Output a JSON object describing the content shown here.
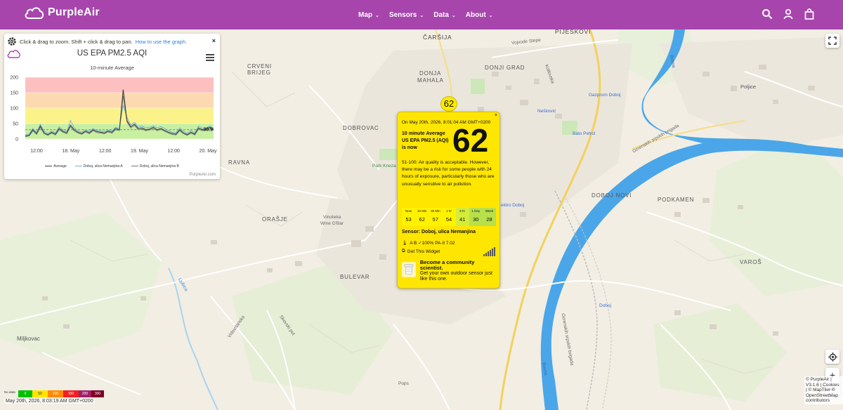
{
  "header": {
    "brand": "PurpleAir",
    "nav": [
      {
        "label": "Map"
      },
      {
        "label": "Sensors"
      },
      {
        "label": "Data"
      },
      {
        "label": "About"
      }
    ],
    "icons": [
      "search-icon",
      "account-icon",
      "cart-icon"
    ]
  },
  "map": {
    "places": [
      {
        "name": "ČARŠIJA"
      },
      {
        "name": "PIJESKOVI"
      },
      {
        "name": "CRVENI"
      },
      {
        "name": "BRIJEG"
      },
      {
        "name": "DONJA"
      },
      {
        "name": "MAHALA"
      },
      {
        "name": "DONJI GRAD"
      },
      {
        "name": "DOBROVAC"
      },
      {
        "name": "RAVNA"
      },
      {
        "name": "ORAŠJE"
      },
      {
        "name": "BULEVAR"
      },
      {
        "name": "DOBOJ NOVI"
      },
      {
        "name": "PODKAMEN"
      },
      {
        "name": "VAROŠ"
      },
      {
        "name": "Miljkovac"
      },
      {
        "name": "Poljice"
      }
    ],
    "pois": [
      {
        "name": "Gazprom Doboj"
      },
      {
        "name": "Nešković"
      },
      {
        "name": "Bato Petrol"
      },
      {
        "name": "Park Kneza"
      },
      {
        "name": "Vinoteka"
      },
      {
        "name": "Wine O'Bar"
      },
      {
        "name": "ektro Doboj"
      },
      {
        "name": "Doboj"
      },
      {
        "name": "Pops"
      }
    ],
    "streets": [
      {
        "name": "Vojvode Stepe"
      },
      {
        "name": "Kotlovska"
      },
      {
        "name": "Ozrenskih srpskih brigada"
      },
      {
        "name": "Bosna"
      },
      {
        "name": "Ljubica"
      },
      {
        "name": "Vidovdanska"
      },
      {
        "name": "Skovski put"
      },
      {
        "name": "Ozrenskih srpskih brigada"
      },
      {
        "name": "Bosna"
      }
    ]
  },
  "chart_panel": {
    "help_text": "Click & drag to zoom. Shift + click & drag to pan.",
    "help_link": "How to use the graph.",
    "close": "×",
    "title": "US EPA PM2.5 AQI",
    "subtitle": "10-minute Average",
    "credit": "PurpleAir.com",
    "last_value_label": "30.9"
  },
  "chart_data": {
    "type": "line",
    "title": "US EPA PM2.5 AQI",
    "subtitle": "10-minute Average",
    "ylim": [
      0,
      200
    ],
    "y_ticks": [
      0,
      50,
      100,
      150,
      200
    ],
    "x_ticks": [
      "12:00",
      "18. May",
      "12:00",
      "19. May",
      "12:00",
      "20. May"
    ],
    "bands": [
      {
        "from": 0,
        "to": 50,
        "color": "#c8f0a0"
      },
      {
        "from": 50,
        "to": 100,
        "color": "#fbf28a"
      },
      {
        "from": 100,
        "to": 150,
        "color": "#fcd9b0"
      },
      {
        "from": 150,
        "to": 200,
        "color": "#fdc0c0"
      }
    ],
    "series": [
      {
        "name": "Average",
        "color": "#444444",
        "values": [
          10,
          12,
          30,
          18,
          42,
          20,
          14,
          22,
          16,
          34,
          25,
          20,
          45,
          30,
          22,
          18,
          26,
          20,
          30,
          24,
          22,
          20,
          26,
          22,
          34,
          30,
          160,
          60,
          40,
          48,
          34,
          36,
          30,
          32,
          38,
          30,
          34,
          28,
          22,
          18,
          16,
          30,
          20,
          14,
          22,
          16,
          36,
          30,
          32,
          38,
          30.9
        ]
      },
      {
        "name": "Doboj, ulica Nemanjina A",
        "color": "#6aaee0",
        "values": [
          14,
          16,
          34,
          22,
          48,
          26,
          18,
          26,
          20,
          40,
          30,
          24,
          60,
          36,
          26,
          22,
          30,
          24,
          34,
          28,
          26,
          24,
          30,
          26,
          38,
          34,
          110,
          70,
          46,
          54,
          40,
          42,
          36,
          38,
          42,
          36,
          40,
          34,
          28,
          22,
          20,
          36,
          26,
          18,
          28,
          20,
          42,
          34,
          36,
          42,
          34
        ]
      },
      {
        "name": "Doboj, ulica Nemanjina B",
        "color": "#777777",
        "values": [
          8,
          10,
          26,
          15,
          38,
          17,
          12,
          19,
          13,
          30,
          22,
          17,
          40,
          26,
          19,
          15,
          23,
          17,
          27,
          21,
          19,
          17,
          23,
          19,
          30,
          27,
          140,
          55,
          36,
          44,
          30,
          32,
          27,
          29,
          34,
          27,
          31,
          25,
          19,
          15,
          13,
          27,
          17,
          12,
          19,
          13,
          32,
          27,
          29,
          34,
          28
        ]
      }
    ]
  },
  "marker": {
    "value": "62"
  },
  "popup": {
    "close": "×",
    "date": "On May 20th, 2026, 8:01:04 AM GMT+0200",
    "avg_label": "10 minute Average US EPA PM2.5 (AQI) is now",
    "value": "62",
    "description": "51-100: Air quality is acceptable. However, there may be a risk for some people with 24 hours of exposure, particularly those who are unusually sensitive to air pollution.",
    "history": [
      {
        "label": "Now",
        "value": "53"
      },
      {
        "label": "10 Min",
        "value": "62"
      },
      {
        "label": "30 Min",
        "value": "57"
      },
      {
        "label": "1 hr",
        "value": "54"
      },
      {
        "label": "6 hr",
        "value": "41"
      },
      {
        "label": "1 Day",
        "value": "30"
      },
      {
        "label": "Week",
        "value": "28"
      }
    ],
    "sensor_name": "Sensor: Doboj, ulica Nemanjina",
    "sensor_meta": "A B ✓100% PA-II 7.02",
    "widget_link": "Get This Widget",
    "community_title": "Become a community scientist.",
    "community_text": "Get your own outdoor sensor just like this one."
  },
  "scale": {
    "label": "No data",
    "segments": [
      {
        "value": "0",
        "color": "#00c000"
      },
      {
        "value": "50",
        "color": "#ffe400"
      },
      {
        "value": "100",
        "color": "#ff8a00"
      },
      {
        "value": "150",
        "color": "#ef2020"
      },
      {
        "value": "200",
        "color": "#a0206a"
      },
      {
        "value": "300",
        "color": "#7e0023"
      }
    ]
  },
  "timestamp": "May 20th, 2026, 8:03:19 AM GMT+0200",
  "attribution": "© PurpleAir | V3.1.6 | Cookies | © MapTiler © OpenStreetMap contributors"
}
